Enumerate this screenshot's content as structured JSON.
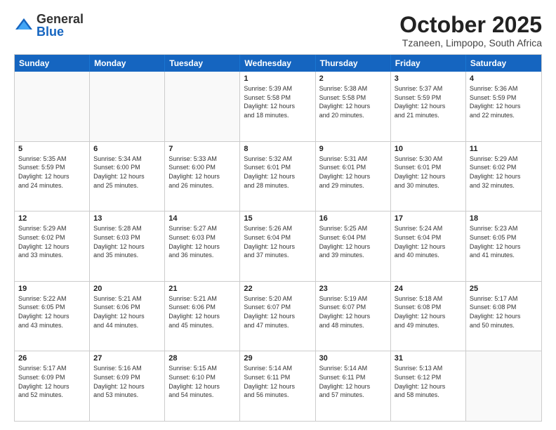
{
  "logo": {
    "general": "General",
    "blue": "Blue"
  },
  "header": {
    "month": "October 2025",
    "location": "Tzaneen, Limpopo, South Africa"
  },
  "weekdays": [
    "Sunday",
    "Monday",
    "Tuesday",
    "Wednesday",
    "Thursday",
    "Friday",
    "Saturday"
  ],
  "weeks": [
    [
      {
        "day": "",
        "info": ""
      },
      {
        "day": "",
        "info": ""
      },
      {
        "day": "",
        "info": ""
      },
      {
        "day": "1",
        "info": "Sunrise: 5:39 AM\nSunset: 5:58 PM\nDaylight: 12 hours\nand 18 minutes."
      },
      {
        "day": "2",
        "info": "Sunrise: 5:38 AM\nSunset: 5:58 PM\nDaylight: 12 hours\nand 20 minutes."
      },
      {
        "day": "3",
        "info": "Sunrise: 5:37 AM\nSunset: 5:59 PM\nDaylight: 12 hours\nand 21 minutes."
      },
      {
        "day": "4",
        "info": "Sunrise: 5:36 AM\nSunset: 5:59 PM\nDaylight: 12 hours\nand 22 minutes."
      }
    ],
    [
      {
        "day": "5",
        "info": "Sunrise: 5:35 AM\nSunset: 5:59 PM\nDaylight: 12 hours\nand 24 minutes."
      },
      {
        "day": "6",
        "info": "Sunrise: 5:34 AM\nSunset: 6:00 PM\nDaylight: 12 hours\nand 25 minutes."
      },
      {
        "day": "7",
        "info": "Sunrise: 5:33 AM\nSunset: 6:00 PM\nDaylight: 12 hours\nand 26 minutes."
      },
      {
        "day": "8",
        "info": "Sunrise: 5:32 AM\nSunset: 6:01 PM\nDaylight: 12 hours\nand 28 minutes."
      },
      {
        "day": "9",
        "info": "Sunrise: 5:31 AM\nSunset: 6:01 PM\nDaylight: 12 hours\nand 29 minutes."
      },
      {
        "day": "10",
        "info": "Sunrise: 5:30 AM\nSunset: 6:01 PM\nDaylight: 12 hours\nand 30 minutes."
      },
      {
        "day": "11",
        "info": "Sunrise: 5:29 AM\nSunset: 6:02 PM\nDaylight: 12 hours\nand 32 minutes."
      }
    ],
    [
      {
        "day": "12",
        "info": "Sunrise: 5:29 AM\nSunset: 6:02 PM\nDaylight: 12 hours\nand 33 minutes."
      },
      {
        "day": "13",
        "info": "Sunrise: 5:28 AM\nSunset: 6:03 PM\nDaylight: 12 hours\nand 35 minutes."
      },
      {
        "day": "14",
        "info": "Sunrise: 5:27 AM\nSunset: 6:03 PM\nDaylight: 12 hours\nand 36 minutes."
      },
      {
        "day": "15",
        "info": "Sunrise: 5:26 AM\nSunset: 6:04 PM\nDaylight: 12 hours\nand 37 minutes."
      },
      {
        "day": "16",
        "info": "Sunrise: 5:25 AM\nSunset: 6:04 PM\nDaylight: 12 hours\nand 39 minutes."
      },
      {
        "day": "17",
        "info": "Sunrise: 5:24 AM\nSunset: 6:04 PM\nDaylight: 12 hours\nand 40 minutes."
      },
      {
        "day": "18",
        "info": "Sunrise: 5:23 AM\nSunset: 6:05 PM\nDaylight: 12 hours\nand 41 minutes."
      }
    ],
    [
      {
        "day": "19",
        "info": "Sunrise: 5:22 AM\nSunset: 6:05 PM\nDaylight: 12 hours\nand 43 minutes."
      },
      {
        "day": "20",
        "info": "Sunrise: 5:21 AM\nSunset: 6:06 PM\nDaylight: 12 hours\nand 44 minutes."
      },
      {
        "day": "21",
        "info": "Sunrise: 5:21 AM\nSunset: 6:06 PM\nDaylight: 12 hours\nand 45 minutes."
      },
      {
        "day": "22",
        "info": "Sunrise: 5:20 AM\nSunset: 6:07 PM\nDaylight: 12 hours\nand 47 minutes."
      },
      {
        "day": "23",
        "info": "Sunrise: 5:19 AM\nSunset: 6:07 PM\nDaylight: 12 hours\nand 48 minutes."
      },
      {
        "day": "24",
        "info": "Sunrise: 5:18 AM\nSunset: 6:08 PM\nDaylight: 12 hours\nand 49 minutes."
      },
      {
        "day": "25",
        "info": "Sunrise: 5:17 AM\nSunset: 6:08 PM\nDaylight: 12 hours\nand 50 minutes."
      }
    ],
    [
      {
        "day": "26",
        "info": "Sunrise: 5:17 AM\nSunset: 6:09 PM\nDaylight: 12 hours\nand 52 minutes."
      },
      {
        "day": "27",
        "info": "Sunrise: 5:16 AM\nSunset: 6:09 PM\nDaylight: 12 hours\nand 53 minutes."
      },
      {
        "day": "28",
        "info": "Sunrise: 5:15 AM\nSunset: 6:10 PM\nDaylight: 12 hours\nand 54 minutes."
      },
      {
        "day": "29",
        "info": "Sunrise: 5:14 AM\nSunset: 6:11 PM\nDaylight: 12 hours\nand 56 minutes."
      },
      {
        "day": "30",
        "info": "Sunrise: 5:14 AM\nSunset: 6:11 PM\nDaylight: 12 hours\nand 57 minutes."
      },
      {
        "day": "31",
        "info": "Sunrise: 5:13 AM\nSunset: 6:12 PM\nDaylight: 12 hours\nand 58 minutes."
      },
      {
        "day": "",
        "info": ""
      }
    ]
  ]
}
